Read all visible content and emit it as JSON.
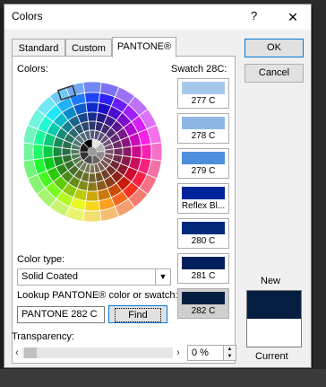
{
  "dialog": {
    "title": "Colors",
    "help_label": "?",
    "close_label": "✕"
  },
  "tabs": [
    {
      "label": "Standard"
    },
    {
      "label": "Custom"
    },
    {
      "label": "PANTONE®"
    }
  ],
  "colors_label": "Colors:",
  "swatch_heading": "Swatch 28C:",
  "swatches": [
    {
      "name": "277 C",
      "color": "#a7c8ea"
    },
    {
      "name": "278 C",
      "color": "#8fb7e6"
    },
    {
      "name": "279 C",
      "color": "#4d8fdc"
    },
    {
      "name": "Reflex Bl...",
      "color": "#00239c"
    },
    {
      "name": "280 C",
      "color": "#012a7a"
    },
    {
      "name": "281 C",
      "color": "#00205c"
    },
    {
      "name": "282 C",
      "color": "#041e42"
    }
  ],
  "color_type": {
    "label": "Color type:",
    "value": "Solid Coated"
  },
  "lookup": {
    "label": "Lookup PANTONE® color or swatch:",
    "value": "PANTONE 282 C",
    "find_label": "Find"
  },
  "buttons": {
    "ok": "OK",
    "cancel": "Cancel"
  },
  "preview": {
    "new_label": "New",
    "current_label": "Current",
    "new_color": "#041e42",
    "current_color": "#ffffff"
  },
  "transparency": {
    "label": "Transparency:",
    "value": "0 %",
    "level": 0
  }
}
